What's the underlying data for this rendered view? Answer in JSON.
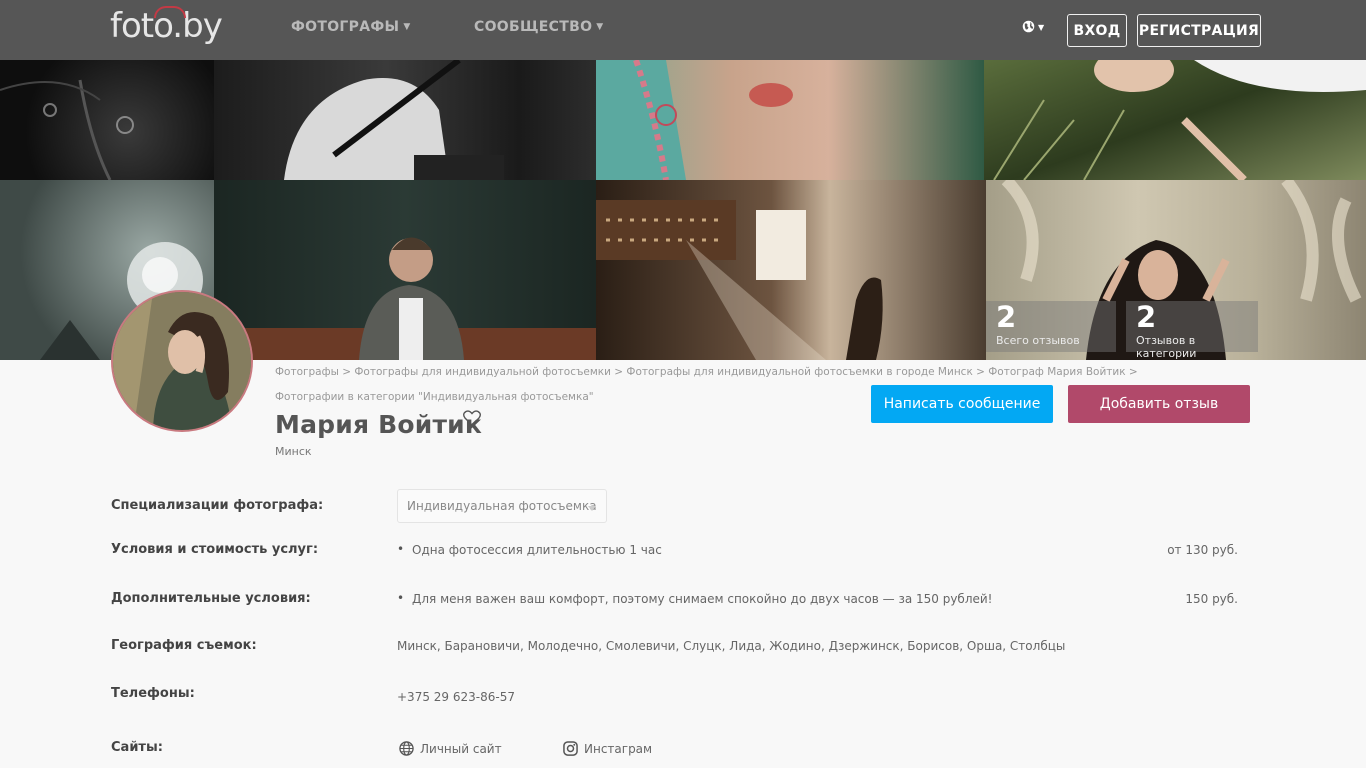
{
  "header": {
    "logo_text": "foto.by",
    "nav": [
      {
        "label": "ФОТОГРАФЫ"
      },
      {
        "label": "СООБЩЕСТВО"
      }
    ],
    "login_label": "ВХОД",
    "register_label": "РЕГИСТРАЦИЯ"
  },
  "stats": [
    {
      "num": "2",
      "label": "Всего отзывов"
    },
    {
      "num": "2",
      "label": "Отзывов в категории"
    }
  ],
  "breadcrumb": {
    "line1": "Фотографы > Фотографы для индивидуальной фотосъемки > Фотографы для индивидуальной фотосъемки в городе Минск > Фотограф Мария Войтик >",
    "line2": "Фотографии в категории \"Индивидуальная фотосъемка\""
  },
  "profile": {
    "name": "Мария Войтик",
    "city": "Минск"
  },
  "actions": {
    "message_label": "Написать сообщение",
    "review_label": "Добавить отзыв"
  },
  "details": {
    "specializations_label": "Специализации фотографа:",
    "specialization_selected": "Индивидуальная фотосъемка",
    "services_label": "Условия и стоимость услуг:",
    "service_text": "Одна фотосессия длительностью 1 час",
    "service_price": "от 130 руб.",
    "extra_label": "Дополнительные условия:",
    "extra_text": "Для меня важен ваш комфорт, поэтому снимаем спокойно до двух часов — за 150 рублей!",
    "extra_price": "150 руб.",
    "geo_label": "География съемок:",
    "geo_text": "Минск, Барановичи, Молодечно, Смолевичи, Слуцк, Лида, Жодино, Дзержинск, Борисов, Орша, Столбцы",
    "phones_label": "Телефоны:",
    "phone": "+375 29 623-86-57",
    "sites_label": "Сайты:",
    "site_personal": "Личный сайт",
    "site_instagram": "Инстаграм"
  },
  "colors": {
    "header_bg": "#565656",
    "message_button": "#03a8f3",
    "review_button": "#b1496a",
    "logo_accent": "#c23a45"
  }
}
